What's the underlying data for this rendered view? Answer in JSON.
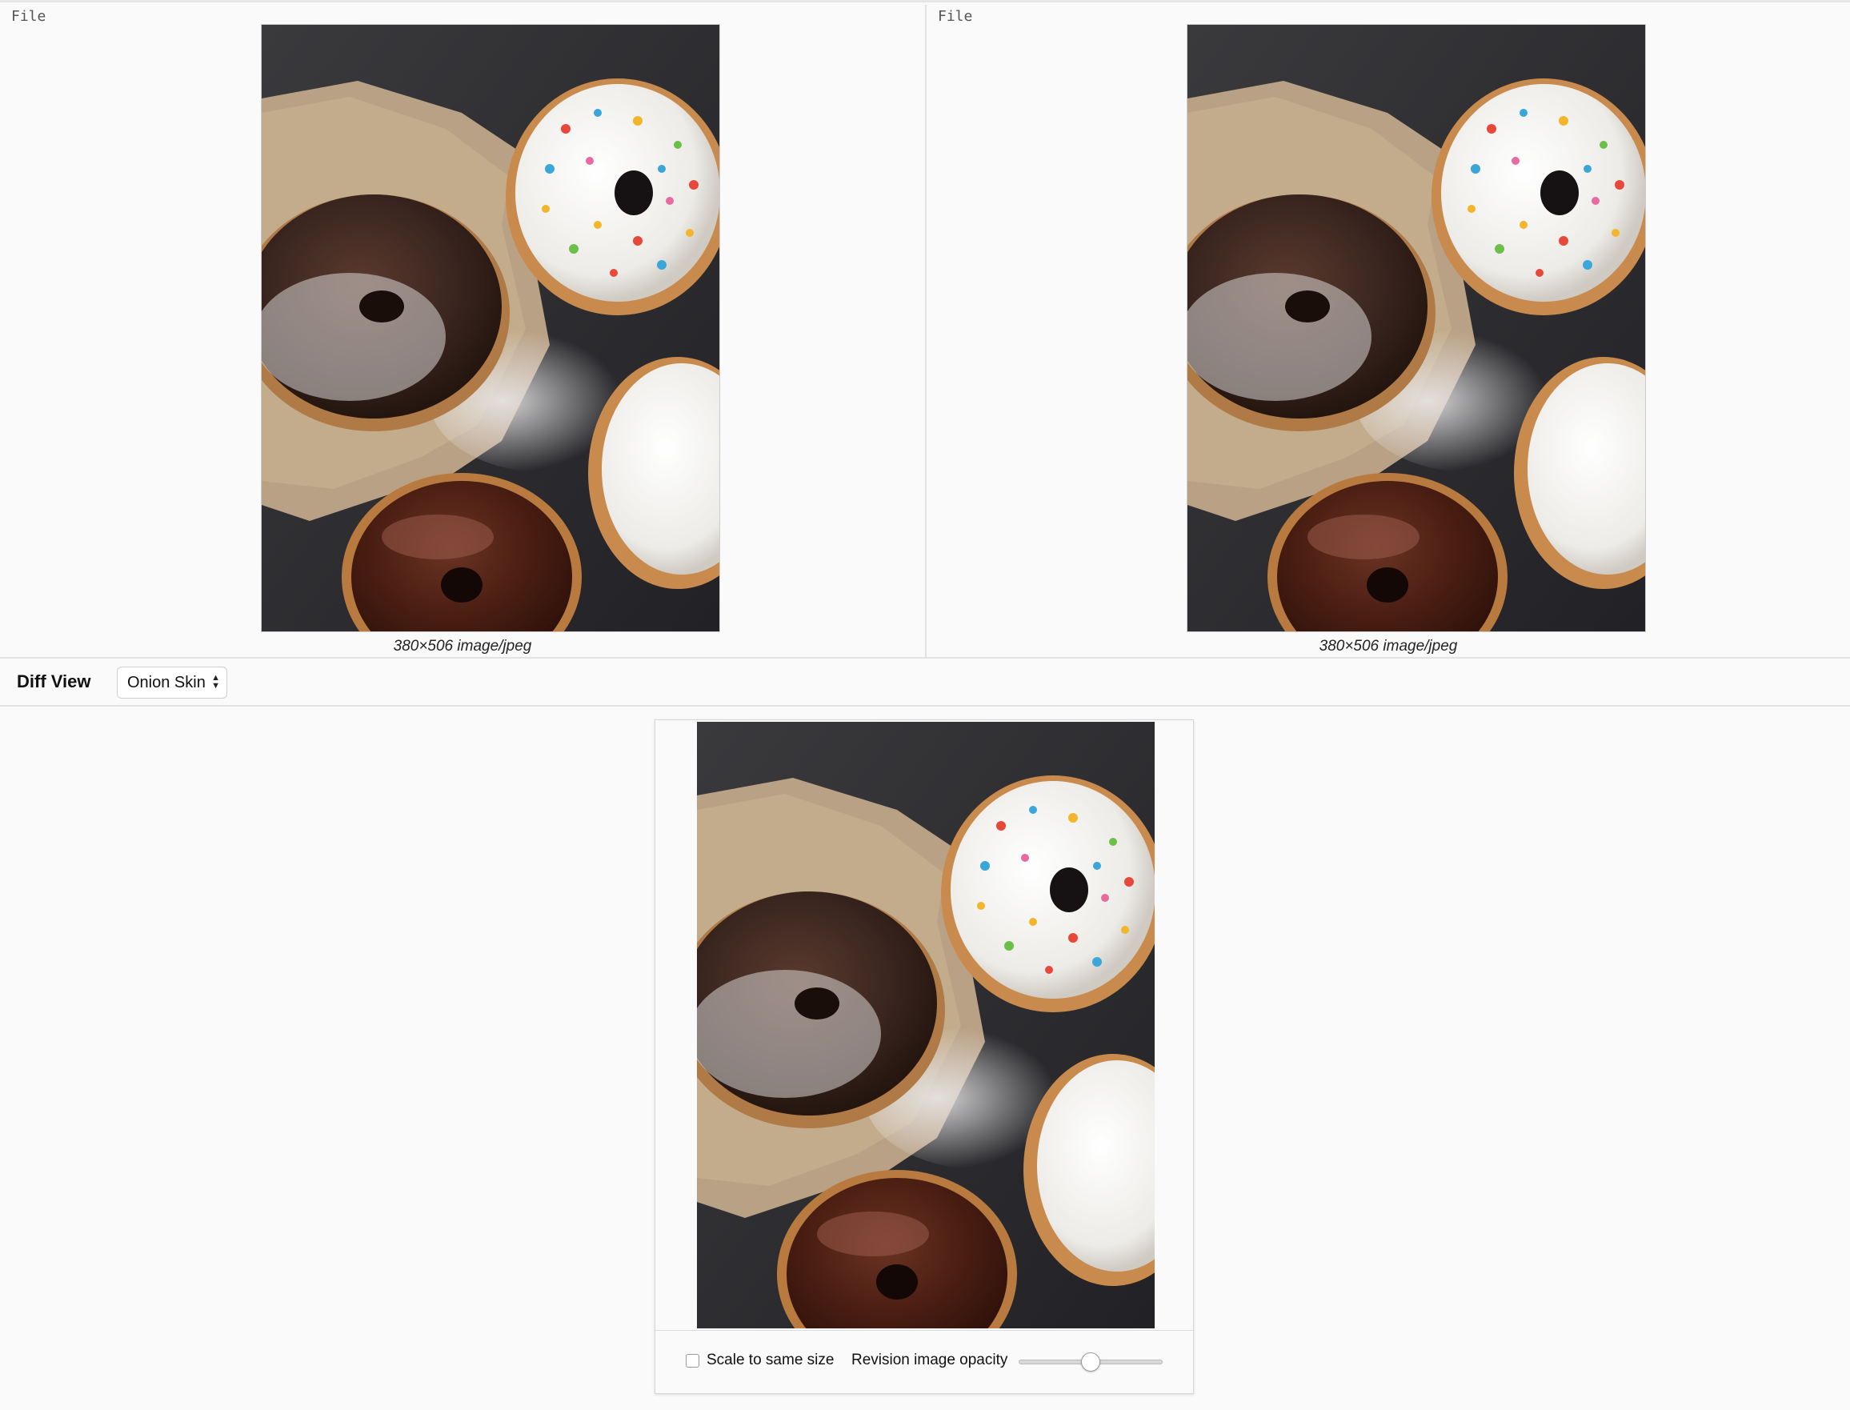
{
  "left_pane": {
    "label": "File",
    "caption": "380×506 image/jpeg",
    "image_alt": "donuts"
  },
  "right_pane": {
    "label": "File",
    "caption": "380×506 image/jpeg",
    "image_alt": "donuts"
  },
  "toolbar": {
    "title": "Diff View",
    "mode_selected": "Onion Skin"
  },
  "onion": {
    "image_alt": "donuts",
    "scale_checkbox_label": "Scale to same size",
    "scale_checked": false,
    "opacity_label": "Revision image opacity",
    "opacity_value": 0.5
  },
  "colors": {
    "background": "#fafafa",
    "border": "#e2e2e2",
    "text": "#222222"
  }
}
